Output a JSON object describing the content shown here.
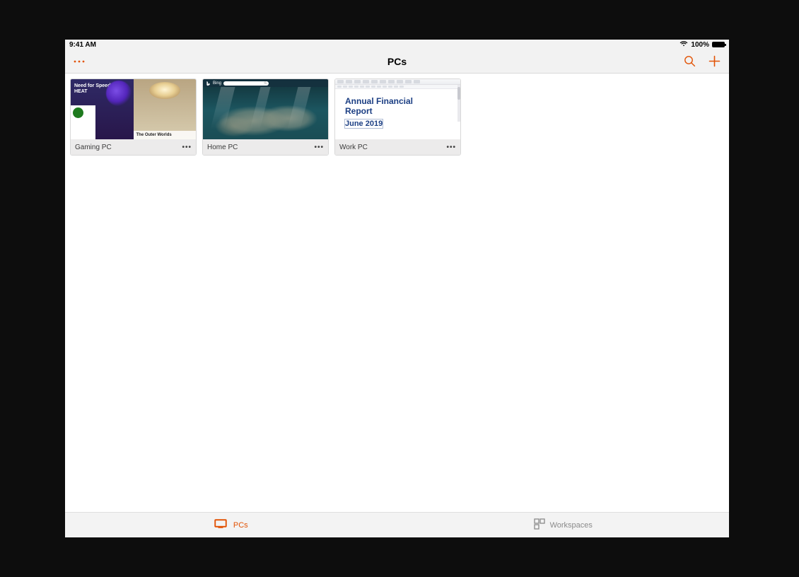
{
  "statusbar": {
    "time": "9:41 AM",
    "battery_pct": "100%"
  },
  "navbar": {
    "title": "PCs"
  },
  "tiles": [
    {
      "label": "Gaming PC",
      "gaming": {
        "hero_title": "Need for Speed™ HEAT",
        "caption_title": "The Outer Worlds"
      }
    },
    {
      "label": "Home PC",
      "bing_label": "Bing"
    },
    {
      "label": "Work PC",
      "doc": {
        "line1": "Annual Financial",
        "line2": "Report",
        "subtitle": "June 2019"
      }
    }
  ],
  "bottombar": {
    "pcs_label": "PCs",
    "workspaces_label": "Workspaces"
  },
  "more_glyph": "•••"
}
